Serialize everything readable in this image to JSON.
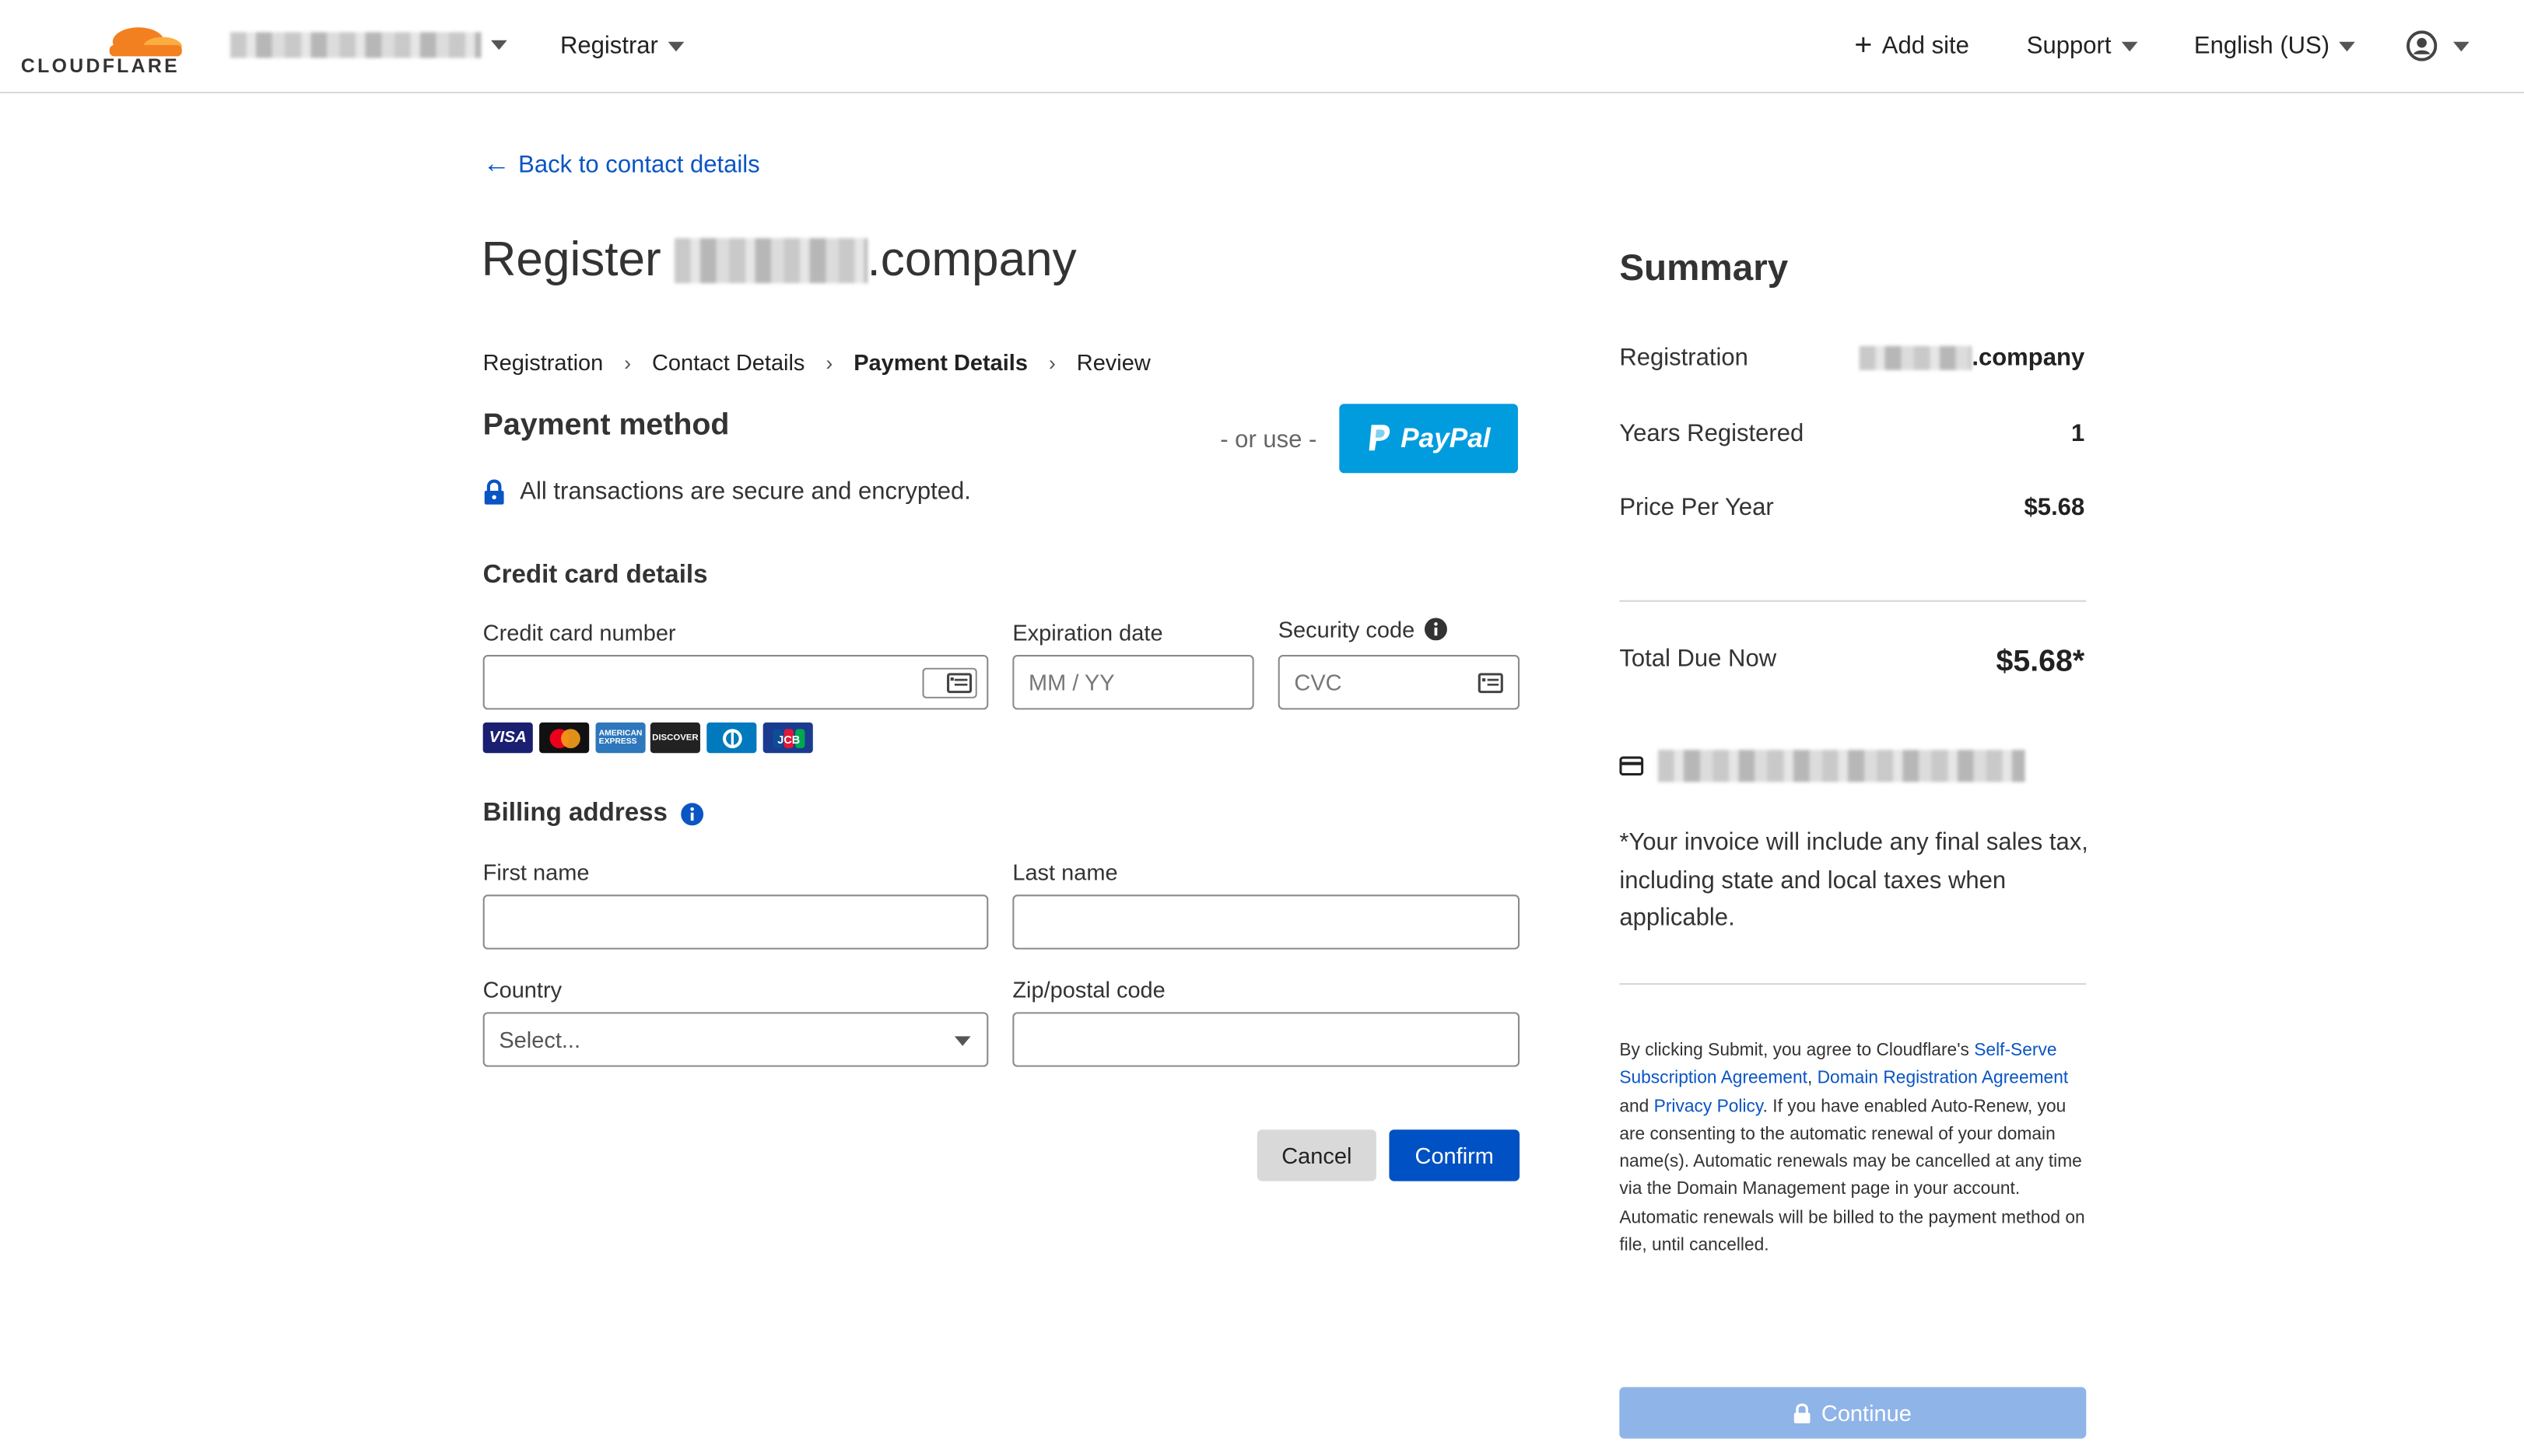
{
  "header": {
    "logo_text": "CLOUDFLARE",
    "account_name_redacted": "",
    "registrar_label": "Registrar",
    "add_site_label": "Add site",
    "support_label": "Support",
    "language_label": "English (US)"
  },
  "back_link": "Back to contact details",
  "page_title": {
    "prefix": "Register",
    "suffix": ".company"
  },
  "breadcrumb": {
    "items": [
      "Registration",
      "Contact Details",
      "Payment Details",
      "Review"
    ],
    "separator": "›"
  },
  "payment": {
    "heading": "Payment method",
    "or_use": "- or use -",
    "paypal_label": "PayPal",
    "secure_text": "All transactions are secure and encrypted."
  },
  "credit_card": {
    "heading": "Credit card details",
    "number_label": "Credit card number",
    "expiration_label": "Expiration date",
    "expiration_placeholder": "MM / YY",
    "security_label": "Security code",
    "security_placeholder": "CVC",
    "brands": [
      "VISA",
      "Mastercard",
      "American Express",
      "Discover",
      "Diners Club",
      "JCB"
    ]
  },
  "billing": {
    "heading": "Billing address",
    "first_name_label": "First name",
    "last_name_label": "Last name",
    "country_label": "Country",
    "country_placeholder": "Select...",
    "zip_label": "Zip/postal code"
  },
  "actions": {
    "cancel_label": "Cancel",
    "confirm_label": "Confirm"
  },
  "summary": {
    "heading": "Summary",
    "registration_label": "Registration",
    "registration_value_suffix": ".company",
    "years_label": "Years Registered",
    "years_value": "1",
    "price_label": "Price Per Year",
    "price_value": "$5.68",
    "total_label": "Total Due Now",
    "total_value": "$5.68*",
    "invoice_note": "*Your invoice will include any final sales tax, including state and local taxes when applicable.",
    "legal": {
      "p1": "By clicking Submit, you agree to Cloudflare's ",
      "link1": "Self-Serve Subscription Agreement",
      "p2": ", ",
      "link2": "Domain Registration Agreement",
      "p3": " and ",
      "link3": "Privacy Policy",
      "p4": ". If you have enabled Auto-Renew, you are consenting to the automatic renewal of your domain name(s). Automatic renewals may be cancelled at any time via the Domain Management page in your account. Automatic renewals will be billed to the payment method on file, until cancelled."
    },
    "continue_label": "Continue"
  },
  "colors": {
    "brand_orange": "#f38020",
    "link_blue": "#0a55c4",
    "confirm_blue": "#0051c3",
    "paypal_blue": "#009cde",
    "continue_disabled": "#8fb4e8"
  }
}
